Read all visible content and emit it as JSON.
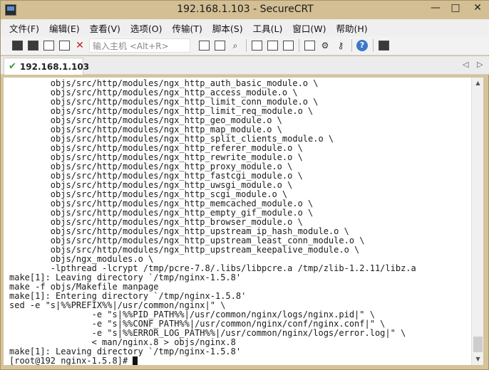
{
  "window": {
    "title": "192.168.1.103 - SecureCRT",
    "minimize_glyph": "—",
    "maximize_glyph": "□",
    "close_glyph": "✕"
  },
  "menu": {
    "items": [
      "文件(F)",
      "编辑(E)",
      "查看(V)",
      "选项(O)",
      "传输(T)",
      "脚本(S)",
      "工具(L)",
      "窗口(W)",
      "帮助(H)"
    ]
  },
  "toolbar": {
    "host_placeholder": "输入主机 <Alt+R>",
    "icons": [
      "connect-icon",
      "quick-connect-icon",
      "connect-tab-icon",
      "reconnect-icon",
      "disconnect-icon",
      "copy-icon",
      "paste-icon",
      "find-icon",
      "print-screen-icon",
      "print-selection-icon",
      "print-icon",
      "session-options-icon",
      "global-options-icon",
      "keymap-icon",
      "help-icon",
      "sftp-icon"
    ]
  },
  "tabs": {
    "active_label": "192.168.1.103",
    "prev_glyph": "◁",
    "next_glyph": "▷"
  },
  "terminal": {
    "lines": [
      "        objs/src/http/modules/ngx_http_auth_basic_module.o \\",
      "        objs/src/http/modules/ngx_http_access_module.o \\",
      "        objs/src/http/modules/ngx_http_limit_conn_module.o \\",
      "        objs/src/http/modules/ngx_http_limit_req_module.o \\",
      "        objs/src/http/modules/ngx_http_geo_module.o \\",
      "        objs/src/http/modules/ngx_http_map_module.o \\",
      "        objs/src/http/modules/ngx_http_split_clients_module.o \\",
      "        objs/src/http/modules/ngx_http_referer_module.o \\",
      "        objs/src/http/modules/ngx_http_rewrite_module.o \\",
      "        objs/src/http/modules/ngx_http_proxy_module.o \\",
      "        objs/src/http/modules/ngx_http_fastcgi_module.o \\",
      "        objs/src/http/modules/ngx_http_uwsgi_module.o \\",
      "        objs/src/http/modules/ngx_http_scgi_module.o \\",
      "        objs/src/http/modules/ngx_http_memcached_module.o \\",
      "        objs/src/http/modules/ngx_http_empty_gif_module.o \\",
      "        objs/src/http/modules/ngx_http_browser_module.o \\",
      "        objs/src/http/modules/ngx_http_upstream_ip_hash_module.o \\",
      "        objs/src/http/modules/ngx_http_upstream_least_conn_module.o \\",
      "        objs/src/http/modules/ngx_http_upstream_keepalive_module.o \\",
      "        objs/ngx_modules.o \\",
      "        -lpthread -lcrypt /tmp/pcre-7.8/.libs/libpcre.a /tmp/zlib-1.2.11/libz.a",
      "make[1]: Leaving directory `/tmp/nginx-1.5.8'",
      "make -f objs/Makefile manpage",
      "make[1]: Entering directory `/tmp/nginx-1.5.8'",
      "sed -e \"s|%%PREFIX%%|/usr/common/nginx|\" \\",
      "                -e \"s|%%PID_PATH%%|/usr/common/nginx/logs/nginx.pid|\" \\",
      "                -e \"s|%%CONF_PATH%%|/usr/common/nginx/conf/nginx.conf|\" \\",
      "                -e \"s|%%ERROR_LOG_PATH%%|/usr/common/nginx/logs/error.log|\" \\",
      "                < man/nginx.8 > objs/nginx.8",
      "make[1]: Leaving directory `/tmp/nginx-1.5.8'"
    ],
    "prompt": "[root@192 nginx-1.5.8]# "
  },
  "scrollbar": {
    "up_glyph": "▲",
    "down_glyph": "▼"
  }
}
